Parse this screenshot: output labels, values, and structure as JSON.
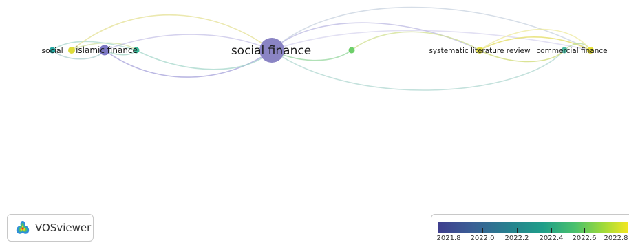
{
  "network": {
    "nodes": [
      {
        "id": "social",
        "label": "social",
        "color": "#23a6a0"
      },
      {
        "id": "yellow-left",
        "label": "",
        "color": "#dedc3a"
      },
      {
        "id": "islamic-finance",
        "label": "islamic finance",
        "color": "#7b76c2"
      },
      {
        "id": "teal-small",
        "label": "",
        "color": "#3cb899"
      },
      {
        "id": "social-finance",
        "label": "social finance",
        "color": "#8a84c4"
      },
      {
        "id": "green-mid",
        "label": "",
        "color": "#6dcf6a"
      },
      {
        "id": "systematic-literature-review",
        "label": "systematic literature review",
        "color": "#e3e04a"
      },
      {
        "id": "teal-right",
        "label": "",
        "color": "#4fb9a3"
      },
      {
        "id": "commercial-finance",
        "label": "commercial finance",
        "color": "#e6df38"
      }
    ]
  },
  "logo": {
    "text": "VOSviewer",
    "icon": "vosviewer-logo-icon"
  },
  "legend": {
    "ticks": [
      "2021.8",
      "2022.0",
      "2022.2",
      "2022.4",
      "2022.6",
      "2022.8"
    ],
    "colors": [
      "#3f3f8e",
      "#26828e",
      "#1f9e89",
      "#4ac16d",
      "#a0da39",
      "#f3e722"
    ]
  }
}
